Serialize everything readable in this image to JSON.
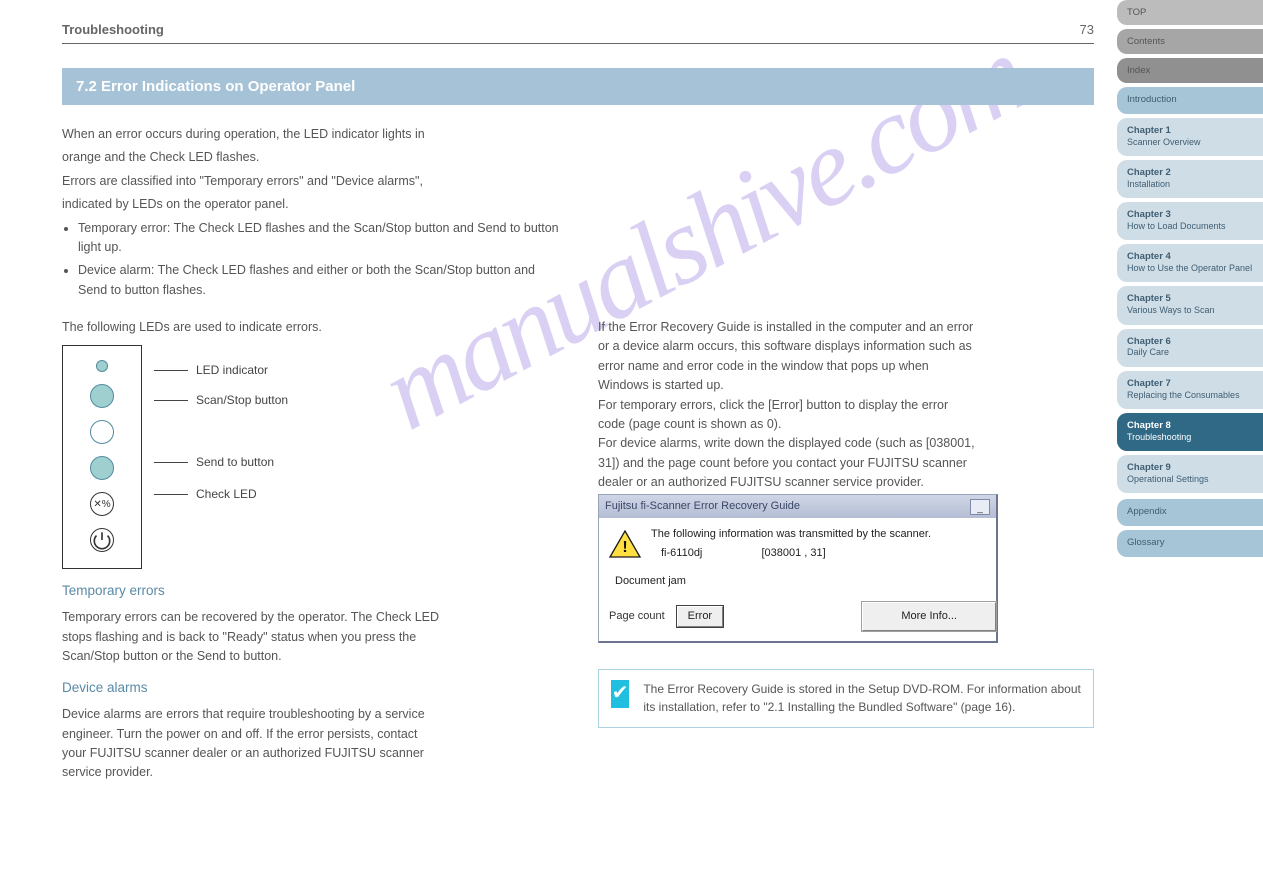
{
  "header": {
    "title": "Troubleshooting",
    "page": "73"
  },
  "section_title": "7.2 Error Indications on Operator Panel",
  "intro_lines": [
    "When an error occurs during operation, the LED indicator lights in",
    "orange and the Check LED flashes.",
    "Errors are classified into \"Temporary errors\" and \"Device alarms\",",
    "indicated by LEDs on the operator panel."
  ],
  "err_types": [
    "Temporary error: The Check LED flashes and the Scan/Stop button and Send to button light up.",
    "Device alarm: The Check LED flashes and either or both the Scan/Stop button and Send to button flashes."
  ],
  "leds_heading": "The following LEDs are used to indicate errors.",
  "led_labels": [
    "LED indicator",
    "Scan/Stop button",
    "Send to button",
    "Check LED"
  ],
  "temp_heading": "Temporary errors",
  "temp_text": [
    "Temporary errors can be recovered by the operator. The Check LED",
    "stops flashing and is back to \"Ready\" status when you press the",
    "Scan/Stop button or the Send to button."
  ],
  "device_heading": "Device alarms",
  "device_text": [
    "Device alarms are errors that require troubleshooting by a service",
    "engineer. Turn the power on and off. If the error persists, contact",
    "your FUJITSU scanner dealer or an authorized FUJITSU scanner",
    "service provider."
  ],
  "right_intro": [
    "If the Error Recovery Guide is installed in the computer and an error",
    "or a device alarm occurs, this software displays information such as",
    "error name and error code in the window that pops up when",
    "Windows is started up.",
    "For temporary errors, click the [Error] button to display the error",
    "code (page count is shown as 0).",
    "For device alarms, write down the displayed code (such as [038001,",
    "31]) and the page count before you contact your FUJITSU scanner",
    "dealer or an authorized FUJITSU scanner service provider."
  ],
  "dialog": {
    "title": "Fujitsu fi-Scanner Error Recovery Guide",
    "msg": "The following information was transmitted by the scanner.",
    "model": "fi-6110dj",
    "code": "[038001 , 31]",
    "doc": "Document jam",
    "page_count_label": "Page count",
    "error_btn": "Error",
    "more_btn": "More Info..."
  },
  "tip": "The Error Recovery Guide is stored in the Setup DVD-ROM. For information about its installation, refer to \"2.1 Installing the Bundled Software\" (page 16).",
  "sidebar": {
    "top": [
      "TOP",
      "Contents",
      "Index"
    ],
    "items": [
      {
        "t": "Introduction"
      },
      {
        "t": "Chapter 1",
        "s": "Scanner Overview"
      },
      {
        "t": "Chapter 2",
        "s": "Installation"
      },
      {
        "t": "Chapter 3",
        "s": "How to Load Documents"
      },
      {
        "t": "Chapter 4",
        "s": "How to Use the Operator Panel"
      },
      {
        "t": "Chapter 5",
        "s": "Various Ways to Scan"
      },
      {
        "t": "Chapter 6",
        "s": "Daily Care"
      },
      {
        "t": "Chapter 7",
        "s": "Replacing the Consumables"
      },
      {
        "t": "Chapter 8",
        "s": "Troubleshooting"
      },
      {
        "t": "Chapter 9",
        "s": "Operational Settings"
      }
    ],
    "bottom": [
      "Appendix",
      "Glossary"
    ]
  },
  "watermark": "manualshive.com"
}
